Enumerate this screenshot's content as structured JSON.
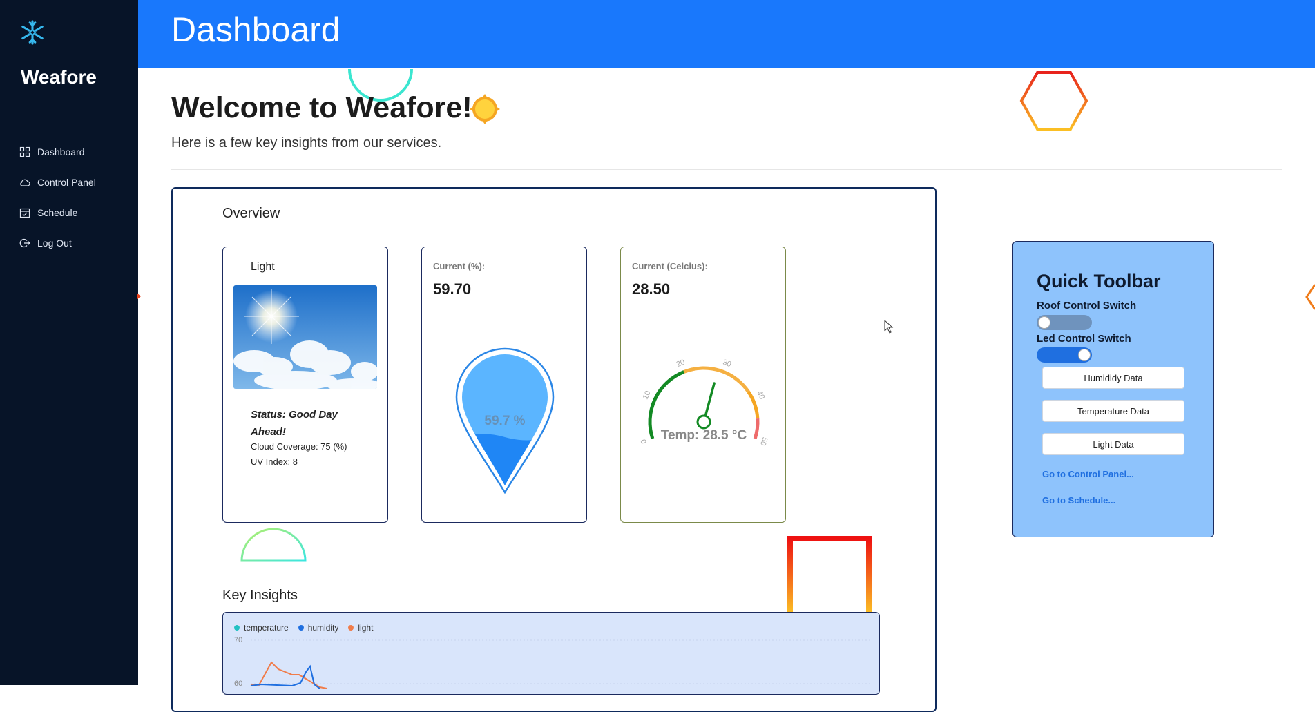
{
  "sidebar": {
    "brand": "Weafore",
    "items": [
      {
        "label": "Dashboard",
        "icon": "grid-icon"
      },
      {
        "label": "Control Panel",
        "icon": "cloud-icon"
      },
      {
        "label": "Schedule",
        "icon": "calendar-icon"
      },
      {
        "label": "Log Out",
        "icon": "logout-icon"
      }
    ]
  },
  "header": {
    "title": "Dashboard"
  },
  "welcome": {
    "title": "Welcome to Weafore!",
    "subtitle": "Here is a few key insights from our services."
  },
  "overview": {
    "title": "Overview",
    "light": {
      "title": "Light",
      "status": "Status: Good Day Ahead!",
      "cloud": "Cloud Coverage: 75 (%)",
      "uv": "UV Index: 8"
    },
    "humidity": {
      "label": "Current (%):",
      "value": "59.70",
      "gauge_text": "59.7 %",
      "level": 0.597
    },
    "temperature": {
      "label": "Current (Celcius):",
      "value": "28.50",
      "gauge_text": "Temp: 28.5 °C",
      "needle_value": 28.5,
      "ticks": [
        "0",
        "10",
        "20",
        "30",
        "40",
        "50"
      ]
    }
  },
  "insights": {
    "title": "Key Insights",
    "chart_data": {
      "type": "line",
      "series": [
        {
          "name": "temperature",
          "color": "#22c1c3"
        },
        {
          "name": "humidity",
          "color": "#1f6fe0"
        },
        {
          "name": "light",
          "color": "#f07c4a"
        }
      ],
      "y_ticks": [
        "70",
        "60"
      ]
    }
  },
  "toolbar": {
    "title": "Quick Toolbar",
    "roof_label": "Roof Control Switch",
    "roof_on": false,
    "led_label": "Led Control Switch",
    "led_on": true,
    "buttons": [
      "Humididy Data",
      "Temperature Data",
      "Light Data"
    ],
    "links": [
      "Go to Control Panel...",
      "Go to Schedule..."
    ]
  },
  "colors": {
    "sidebar": "#071428",
    "header": "#1978fc",
    "toolbar": "#8ec3fc"
  }
}
